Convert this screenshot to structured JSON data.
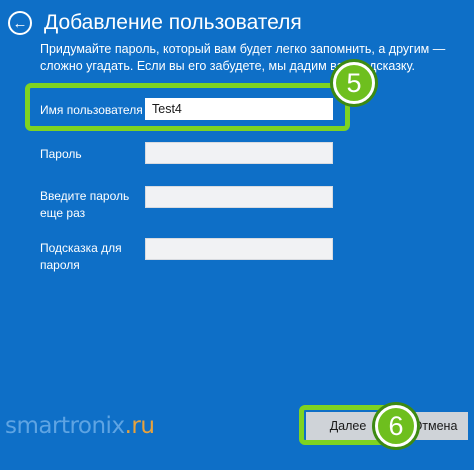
{
  "header": {
    "title": "Добавление пользователя"
  },
  "description": "Придумайте пароль, который вам будет легко запомнить, а другим — сложно угадать. Если вы его забудете, мы дадим вам подсказку.",
  "form": {
    "username_label": "Имя пользователя",
    "username_value": "Test4",
    "password_label": "Пароль",
    "password_value": "",
    "password_repeat_label_line1": "Введите пароль",
    "password_repeat_label_line2": "еще раз",
    "password_repeat_value": "",
    "hint_label_line1": "Подсказка для",
    "hint_label_line2": "пароля",
    "hint_value": ""
  },
  "annotations": {
    "step_5": "5",
    "step_6": "6",
    "highlight_color": "#7ed321"
  },
  "watermark": {
    "name": "smartronix",
    "tld": ".ru"
  },
  "footer": {
    "next_label": "Далее",
    "cancel_label": "Отмена"
  },
  "colors": {
    "background": "#0e6fc7",
    "accent_green": "#7ed321"
  },
  "icons": {
    "back": "back-arrow-icon"
  }
}
